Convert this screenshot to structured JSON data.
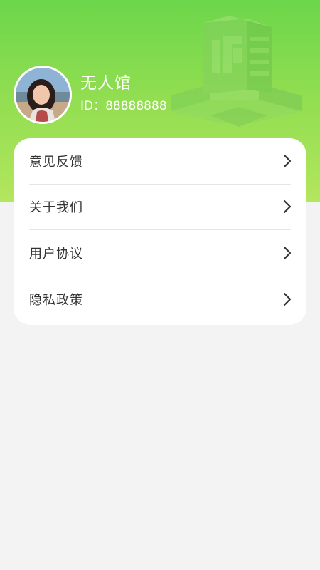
{
  "colors": {
    "header_top": "#6cd64a",
    "header_bottom": "#b3e65e",
    "page_background": "#f3f3f3",
    "card_background": "#ffffff",
    "text_primary": "#333333"
  },
  "profile": {
    "name": "无人馆",
    "id_text": "ID：88888888",
    "avatar_icon": "avatar-photo"
  },
  "menu": {
    "items": [
      {
        "label": "意见反馈",
        "icon": "chevron-right-icon"
      },
      {
        "label": "关于我们",
        "icon": "chevron-right-icon"
      },
      {
        "label": "用户协议",
        "icon": "chevron-right-icon"
      },
      {
        "label": "隐私政策",
        "icon": "chevron-right-icon"
      }
    ]
  }
}
